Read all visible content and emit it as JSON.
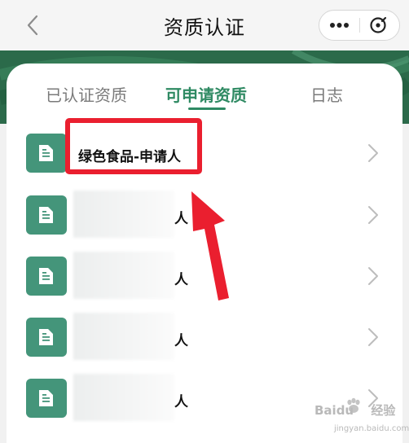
{
  "nav": {
    "title": "资质认证",
    "back_icon": "chevron-left-icon",
    "more_icon": "more-dots-icon",
    "close_icon": "close-circle-icon"
  },
  "tabs": [
    {
      "label": "已认证资质",
      "active": false
    },
    {
      "label": "可申请资质",
      "active": true
    },
    {
      "label": "日志",
      "active": false
    }
  ],
  "list": {
    "items": [
      {
        "label": "绿色食品-申请人",
        "obscured": false
      },
      {
        "label": "人",
        "obscured": true
      },
      {
        "label": "人",
        "obscured": true
      },
      {
        "label": "人",
        "obscured": true
      },
      {
        "label": "人",
        "obscured": true
      }
    ],
    "item_icon": "document-icon",
    "chevron_icon": "chevron-right-icon"
  },
  "colors": {
    "accent": "#2f8a63",
    "banner": "#2b6a4a",
    "icon_bg": "#44957a",
    "annotation": "#ea1f2f"
  },
  "watermark": {
    "brand": "Baidu",
    "brand_suffix": "经验",
    "url": "jingyan.baidu.com"
  }
}
